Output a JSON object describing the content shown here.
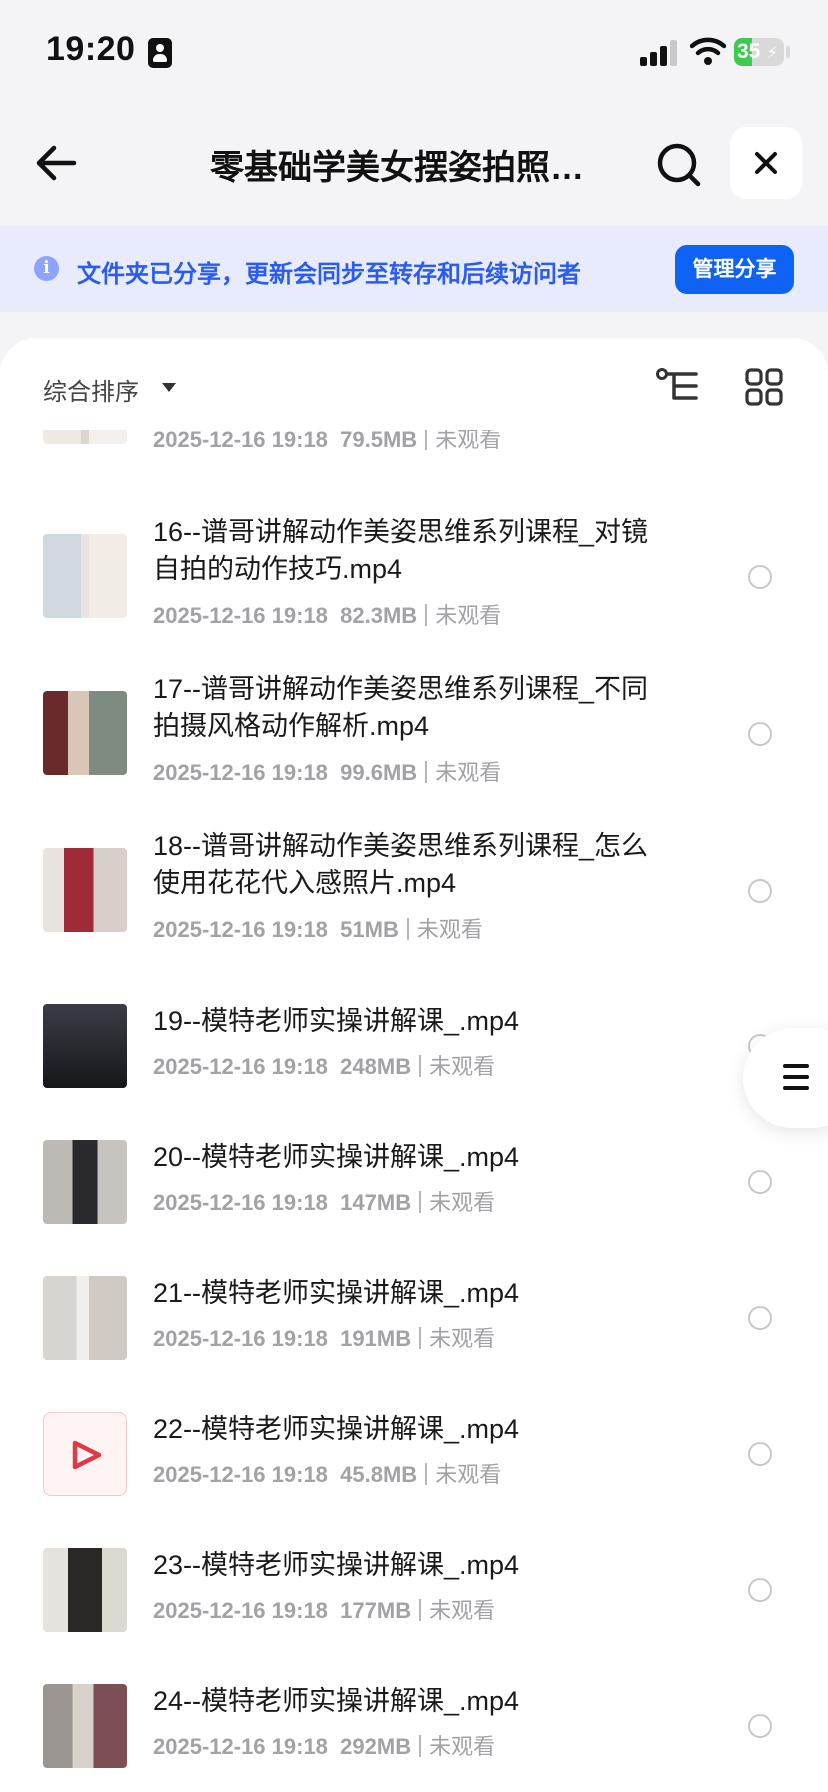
{
  "status_bar": {
    "time": "19:20",
    "battery": "35",
    "battery_level": 0.35
  },
  "nav": {
    "title": "零基础学美女摆姿拍照…"
  },
  "banner": {
    "text": "文件夹已分享，更新会同步至转存和后续访问者",
    "button": "管理分享"
  },
  "toolbar": {
    "sort_label": "综合排序"
  },
  "files": [
    {
      "name": "",
      "date": "2025-12-16 19:18",
      "size": "79.5MB",
      "status": "未观看"
    },
    {
      "name": "16--谱哥讲解动作美姿思维系列课程_对镜自拍的动作技巧.mp4",
      "date": "2025-12-16 19:18",
      "size": "82.3MB",
      "status": "未观看"
    },
    {
      "name": "17--谱哥讲解动作美姿思维系列课程_不同拍摄风格动作解析.mp4",
      "date": "2025-12-16 19:18",
      "size": "99.6MB",
      "status": "未观看"
    },
    {
      "name": "18--谱哥讲解动作美姿思维系列课程_怎么使用花花代入感照片.mp4",
      "date": "2025-12-16 19:18",
      "size": "51MB",
      "status": "未观看"
    },
    {
      "name": "19--模特老师实操讲解课_.mp4",
      "date": "2025-12-16 19:18",
      "size": "248MB",
      "status": "未观看"
    },
    {
      "name": "20--模特老师实操讲解课_.mp4",
      "date": "2025-12-16 19:18",
      "size": "147MB",
      "status": "未观看"
    },
    {
      "name": "21--模特老师实操讲解课_.mp4",
      "date": "2025-12-16 19:18",
      "size": "191MB",
      "status": "未观看"
    },
    {
      "name": "22--模特老师实操讲解课_.mp4",
      "date": "2025-12-16 19:18",
      "size": "45.8MB",
      "status": "未观看"
    },
    {
      "name": "23--模特老师实操讲解课_.mp4",
      "date": "2025-12-16 19:18",
      "size": "177MB",
      "status": "未观看"
    },
    {
      "name": "24--模特老师实操讲解课_.mp4",
      "date": "2025-12-16 19:18",
      "size": "292MB",
      "status": "未观看"
    }
  ],
  "colors": {
    "accent": "#0f63f4",
    "banner_bg": "#e8ebfb",
    "banner_text": "#2a5bf3",
    "battery": "#3ccb4e"
  }
}
